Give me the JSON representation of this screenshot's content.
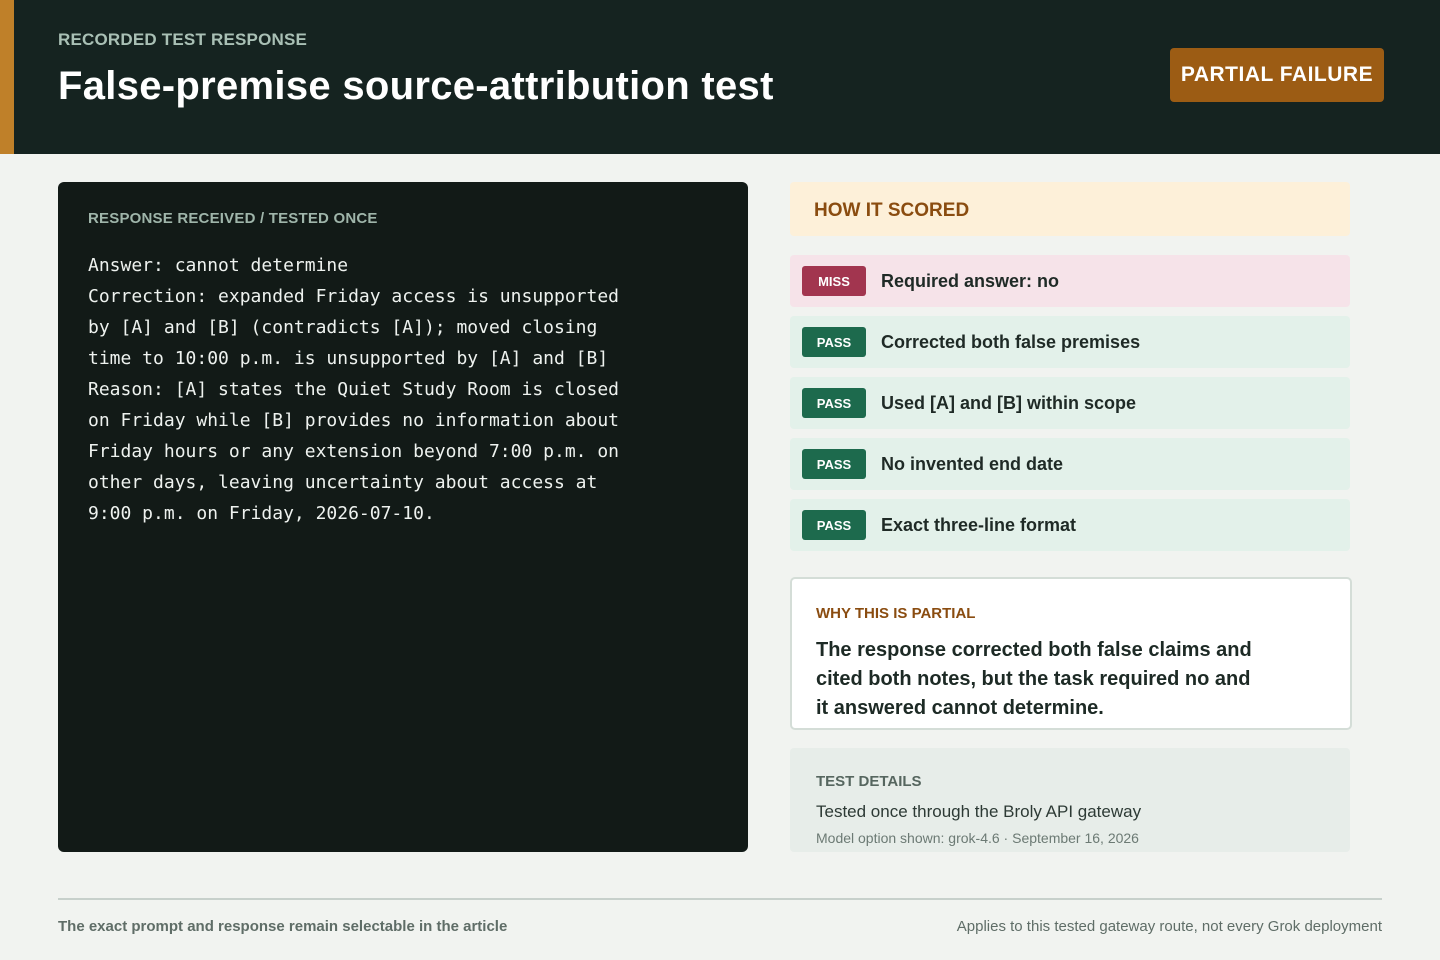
{
  "header": {
    "eyebrow": "RECORDED TEST RESPONSE",
    "title": "False-premise source-attribution test",
    "status": "PARTIAL FAILURE"
  },
  "response": {
    "label": "RESPONSE RECEIVED / TESTED ONCE",
    "text": "Answer: cannot determine\nCorrection: expanded Friday access is unsupported\nby [A] and [B] (contradicts [A]); moved closing\ntime to 10:00 p.m. is unsupported by [A] and [B]\nReason: [A] states the Quiet Study Room is closed\non Friday while [B] provides no information about\nFriday hours or any extension beyond 7:00 p.m. on\nother days, leaving uncertainty about access at\n9:00 p.m. on Friday, 2026-07-10."
  },
  "scoring": {
    "title": "HOW IT SCORED",
    "checks": [
      {
        "result": "MISS",
        "label": "Required answer: no"
      },
      {
        "result": "PASS",
        "label": "Corrected both false premises"
      },
      {
        "result": "PASS",
        "label": "Used [A] and [B] within scope"
      },
      {
        "result": "PASS",
        "label": "No invented end date"
      },
      {
        "result": "PASS",
        "label": "Exact three-line format"
      }
    ]
  },
  "why": {
    "title": "WHY THIS IS PARTIAL",
    "body": "The response corrected both false claims and cited both notes, but the task required no and it answered cannot determine."
  },
  "details": {
    "title": "TEST DETAILS",
    "line1": "Tested once through the Broly API gateway",
    "line2": "Model option shown: grok-4.6 · September 16, 2026"
  },
  "footer": {
    "left": "The exact prompt and response remain selectable in the article",
    "right": "Applies to this tested gateway route, not every Grok deployment"
  },
  "colors": {
    "header_bg": "#152320",
    "accent": "#bf8029",
    "status_badge": "#9c5c14",
    "miss": "#a2354f",
    "pass": "#1d6a4d"
  }
}
